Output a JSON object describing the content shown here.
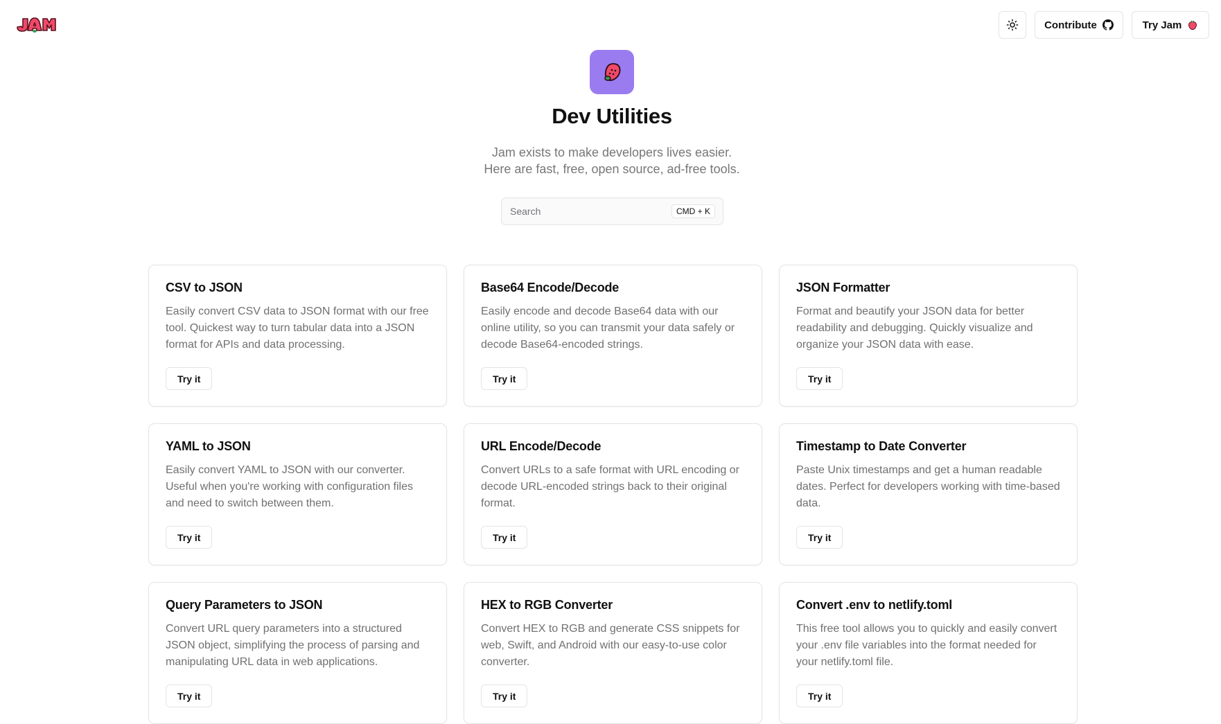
{
  "header": {
    "logo_text": "JAM",
    "theme_toggle_icon": "sun-icon",
    "contribute_label": "Contribute",
    "contribute_icon": "github-icon",
    "try_jam_label": "Try Jam",
    "try_jam_icon": "strawberry-icon"
  },
  "hero": {
    "icon": "strawberry-icon",
    "icon_bg": "#9b7bf0",
    "title": "Dev Utilities",
    "subtitle_line1": "Jam exists to make developers lives easier.",
    "subtitle_line2": "Here are fast, free, open source, ad-free tools."
  },
  "search": {
    "placeholder": "Search",
    "shortcut": "CMD + K"
  },
  "tools": [
    {
      "title": "CSV to JSON",
      "description": "Easily convert CSV data to JSON format with our free tool. Quickest way to turn tabular data into a JSON format for APIs and data processing.",
      "button": "Try it"
    },
    {
      "title": "Base64 Encode/Decode",
      "description": "Easily encode and decode Base64 data with our online utility, so you can transmit your data safely or decode Base64-encoded strings.",
      "button": "Try it"
    },
    {
      "title": "JSON Formatter",
      "description": "Format and beautify your JSON data for better readability and debugging. Quickly visualize and organize your JSON data with ease.",
      "button": "Try it"
    },
    {
      "title": "YAML to JSON",
      "description": "Easily convert YAML to JSON with our converter. Useful when you're working with configuration files and need to switch between them.",
      "button": "Try it"
    },
    {
      "title": "URL Encode/Decode",
      "description": "Convert URLs to a safe format with URL encoding or decode URL-encoded strings back to their original format.",
      "button": "Try it"
    },
    {
      "title": "Timestamp to Date Converter",
      "description": "Paste Unix timestamps and get a human readable dates. Perfect for developers working with time-based data.",
      "button": "Try it"
    },
    {
      "title": "Query Parameters to JSON",
      "description": "Convert URL query parameters into a structured JSON object, simplifying the process of parsing and manipulating URL data in web applications.",
      "button": "Try it"
    },
    {
      "title": "HEX to RGB Converter",
      "description": "Convert HEX to RGB and generate CSS snippets for web, Swift, and Android with our easy-to-use color converter.",
      "button": "Try it"
    },
    {
      "title": "Convert .env to netlify.toml",
      "description": "This free tool allows you to quickly and easily convert your .env file variables into the format needed for your netlify.toml file.",
      "button": "Try it"
    }
  ],
  "colors": {
    "brand": "#e8405e",
    "accent": "#9b7bf0"
  }
}
